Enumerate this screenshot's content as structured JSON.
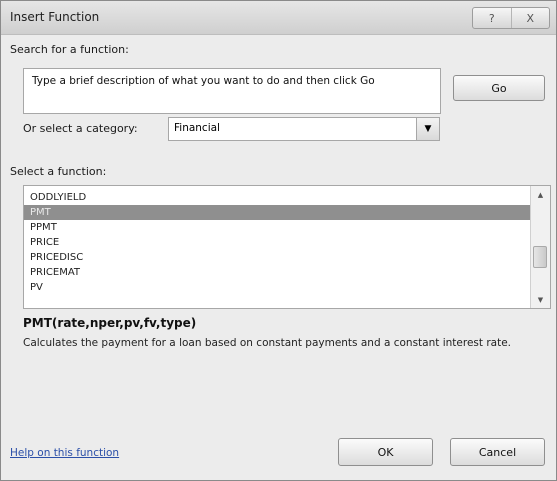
{
  "window": {
    "title": "Insert Function",
    "title_buttons": [
      "?",
      "X"
    ]
  },
  "search": {
    "label": "Search for a function:",
    "description": "Type a brief description of what you want to do and then click Go",
    "go_label": "Go"
  },
  "category": {
    "label": "Or select a category:",
    "selected": "Financial"
  },
  "function_list": {
    "label": "Select a function:",
    "items": [
      "ODDLYIELD",
      "PMT",
      "PPMT",
      "PRICE",
      "PRICEDISC",
      "PRICEMAT",
      "PV"
    ],
    "selected_index": 1
  },
  "function_info": {
    "syntax": "PMT(rate,nper,pv,fv,type)",
    "description": "Calculates the payment for a loan based on constant payments and a constant interest rate."
  },
  "footer": {
    "help_link": "Help on this function",
    "ok_label": "OK",
    "cancel_label": "Cancel"
  },
  "icons": {
    "dropdown_arrow": "▼",
    "scroll_up": "▲",
    "scroll_down": "▼"
  },
  "colors": {
    "selected_row": "#8f8f8f",
    "link": "#2b4fa8"
  }
}
